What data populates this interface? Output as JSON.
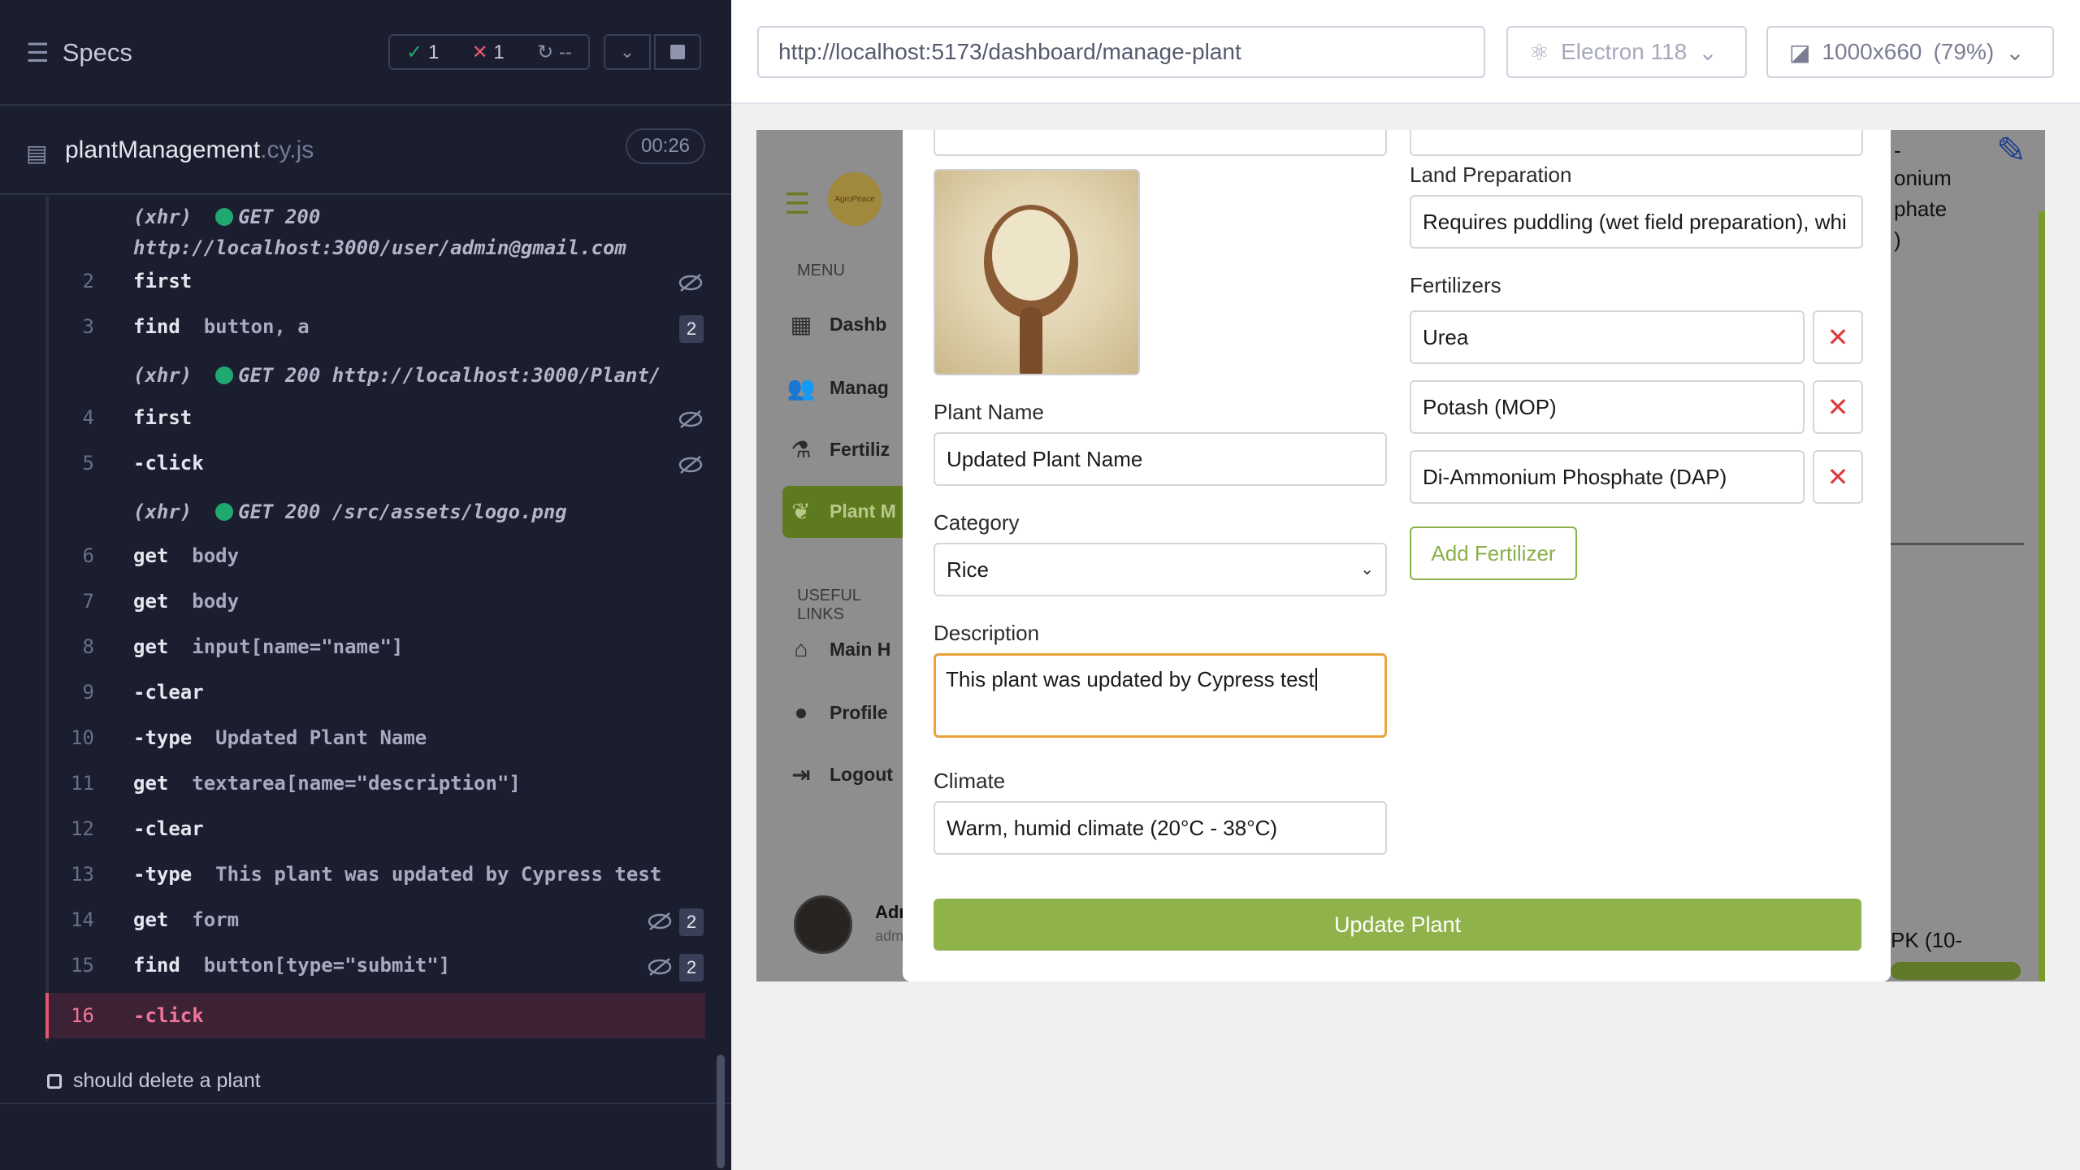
{
  "runner": {
    "title": "Specs",
    "stats": {
      "passed": "1",
      "failed": "1",
      "pending": "--"
    },
    "file": {
      "name": "plantManagement",
      "ext": ".cy.js",
      "duration": "00:26"
    },
    "commands": [
      {
        "type": "xhr",
        "text": "(xhr)",
        "method": "GET 200",
        "url": "http://localhost:3000/user/admin@gmail.com"
      },
      {
        "num": "2",
        "name": "first",
        "msg": ""
      },
      {
        "num": "3",
        "name": "find",
        "msg": "button, a",
        "badge": "2"
      },
      {
        "type": "xhr",
        "text": "(xhr)",
        "method": "GET 200",
        "url": "http://localhost:3000/Plant/"
      },
      {
        "num": "4",
        "name": "first",
        "msg": ""
      },
      {
        "num": "5",
        "name": "-click",
        "msg": ""
      },
      {
        "type": "xhr",
        "text": "(xhr)",
        "method": "GET 200",
        "url": "/src/assets/logo.png"
      },
      {
        "num": "6",
        "name": "get",
        "msg": "body"
      },
      {
        "num": "7",
        "name": "get",
        "msg": "body"
      },
      {
        "num": "8",
        "name": "get",
        "msg": "input[name=\"name\"]"
      },
      {
        "num": "9",
        "name": "-clear",
        "msg": ""
      },
      {
        "num": "10",
        "name": "-type",
        "msg": "Updated Plant Name"
      },
      {
        "num": "11",
        "name": "get",
        "msg": "textarea[name=\"description\"]"
      },
      {
        "num": "12",
        "name": "-clear",
        "msg": ""
      },
      {
        "num": "13",
        "name": "-type",
        "msg": "This plant was updated by Cypress test"
      },
      {
        "num": "14",
        "name": "get",
        "msg": "form",
        "badge": "2"
      },
      {
        "num": "15",
        "name": "find",
        "msg": "button[type=\"submit\"]",
        "badge": "2"
      },
      {
        "num": "16",
        "name": "-click",
        "msg": ""
      }
    ],
    "next_test": "should delete a plant"
  },
  "browser": {
    "url": "http://localhost:5173/dashboard/manage-plant",
    "engine": "Electron 118",
    "viewport": "1000x660",
    "zoom": "(79%)"
  },
  "app": {
    "menu_label": "MENU",
    "nav": [
      "Dashb",
      "Manag",
      "Fertiliz",
      "Plant M"
    ],
    "links_label": "USEFUL LINKS",
    "links": [
      "Main H",
      "Profile",
      "Logout"
    ],
    "admin_name": "Adm",
    "admin_sub": "adm",
    "bg_text": [
      "-",
      "onium",
      "phate",
      ")",
      "PK (10-"
    ]
  },
  "modal": {
    "plant_name_label": "Plant Name",
    "plant_name_value": "Updated Plant Name",
    "category_label": "Category",
    "category_value": "Rice",
    "description_label": "Description",
    "description_value": "This plant was updated by Cypress test",
    "climate_label": "Climate",
    "climate_value": "Warm, humid climate (20°C - 38°C)",
    "land_label": "Land Preparation",
    "land_value": "Requires puddling (wet field preparation), whi",
    "fertilizers_label": "Fertilizers",
    "fertilizers": [
      "Urea",
      "Potash (MOP)",
      "Di-Ammonium Phosphate (DAP)"
    ],
    "add_fertilizer": "Add Fertilizer",
    "submit": "Update Plant"
  },
  "colors": {
    "runner_bg": "#1b1e2e",
    "pass": "#1fa971",
    "fail": "#e45770",
    "accent_green": "#8fb24a",
    "focus_orange": "#e8a33a"
  }
}
